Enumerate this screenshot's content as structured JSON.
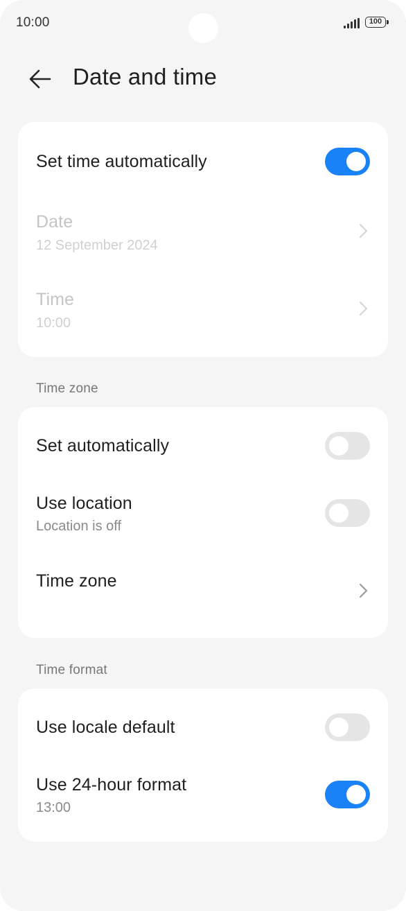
{
  "status_bar": {
    "time": "10:00",
    "battery": "100"
  },
  "header": {
    "title": "Date and time"
  },
  "date_time_card": {
    "auto_time": {
      "label": "Set time automatically",
      "enabled": true
    },
    "date": {
      "label": "Date",
      "value": "12 September 2024"
    },
    "time": {
      "label": "Time",
      "value": "10:00"
    }
  },
  "time_zone_section": {
    "heading": "Time zone",
    "set_auto": {
      "label": "Set automatically",
      "enabled": false
    },
    "use_location": {
      "label": "Use location",
      "sub": "Location is off",
      "enabled": false
    },
    "time_zone": {
      "label": "Time zone"
    }
  },
  "time_format_section": {
    "heading": "Time format",
    "locale_default": {
      "label": "Use locale default",
      "enabled": false
    },
    "hour24": {
      "label": "Use 24-hour format",
      "sub": "13:00",
      "enabled": true
    }
  },
  "colors": {
    "accent": "#1a82f7",
    "background": "#f5f5f5",
    "card": "#ffffff"
  }
}
